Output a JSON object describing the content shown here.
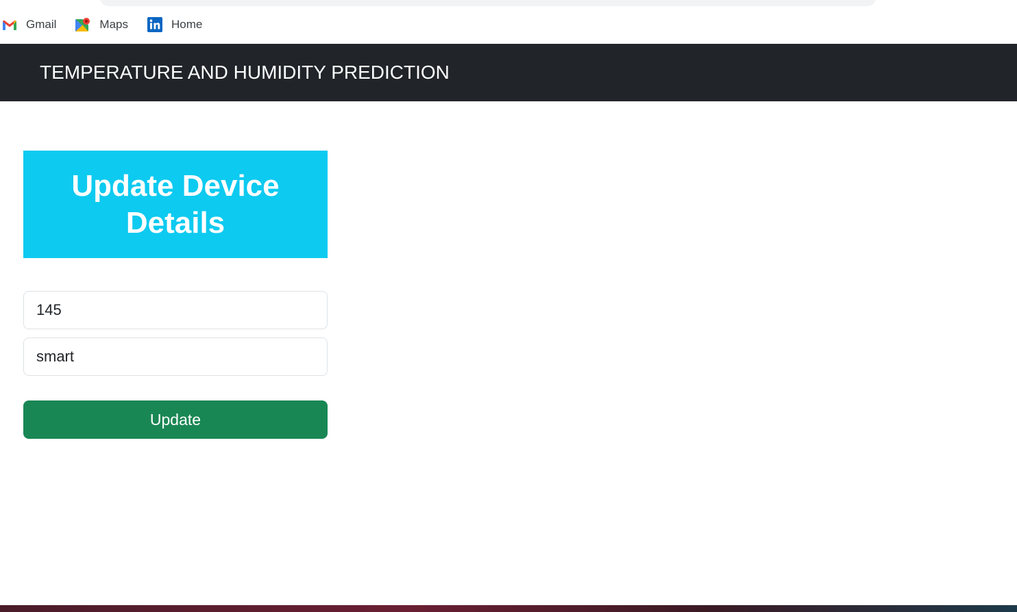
{
  "bookmarks": [
    {
      "label": "Gmail",
      "icon": "gmail-icon"
    },
    {
      "label": "Maps",
      "icon": "maps-icon"
    },
    {
      "label": "Home",
      "icon": "linkedin-icon"
    }
  ],
  "navbar": {
    "brand": "TEMPERATURE AND HUMIDITY PREDICTION",
    "background": "#212529"
  },
  "form": {
    "header_title": "Update Device Details",
    "header_color": "#0dcaf0",
    "device_id_value": "145",
    "device_name_value": "smart",
    "submit_label": "Update",
    "submit_color": "#198754"
  }
}
